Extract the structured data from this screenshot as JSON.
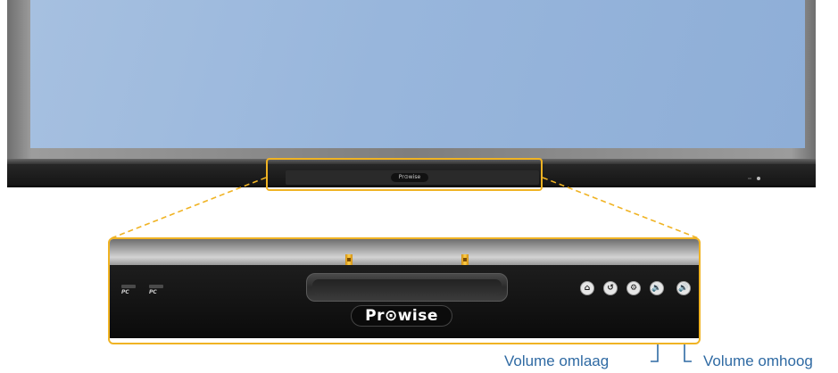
{
  "display": {
    "brand_small": "Pr⊙wise"
  },
  "zoom_panel": {
    "ports": [
      {
        "label": "PC"
      },
      {
        "label": "PC"
      }
    ],
    "brand": "Pr⊙wise",
    "buttons": [
      {
        "icon": "home-icon",
        "glyph": "⌂"
      },
      {
        "icon": "back-icon",
        "glyph": "↺"
      },
      {
        "icon": "settings-icon",
        "glyph": "⚙"
      },
      {
        "icon": "volume-down-icon",
        "glyph": "🔉"
      },
      {
        "icon": "volume-up-icon",
        "glyph": "🔊"
      }
    ]
  },
  "captions": {
    "volume_down": "Volume omlaag",
    "volume_up": "Volume omhoog"
  },
  "colors": {
    "highlight": "#f0b323",
    "caption_text": "#2f6aa3",
    "screen": "#98b6dc"
  }
}
